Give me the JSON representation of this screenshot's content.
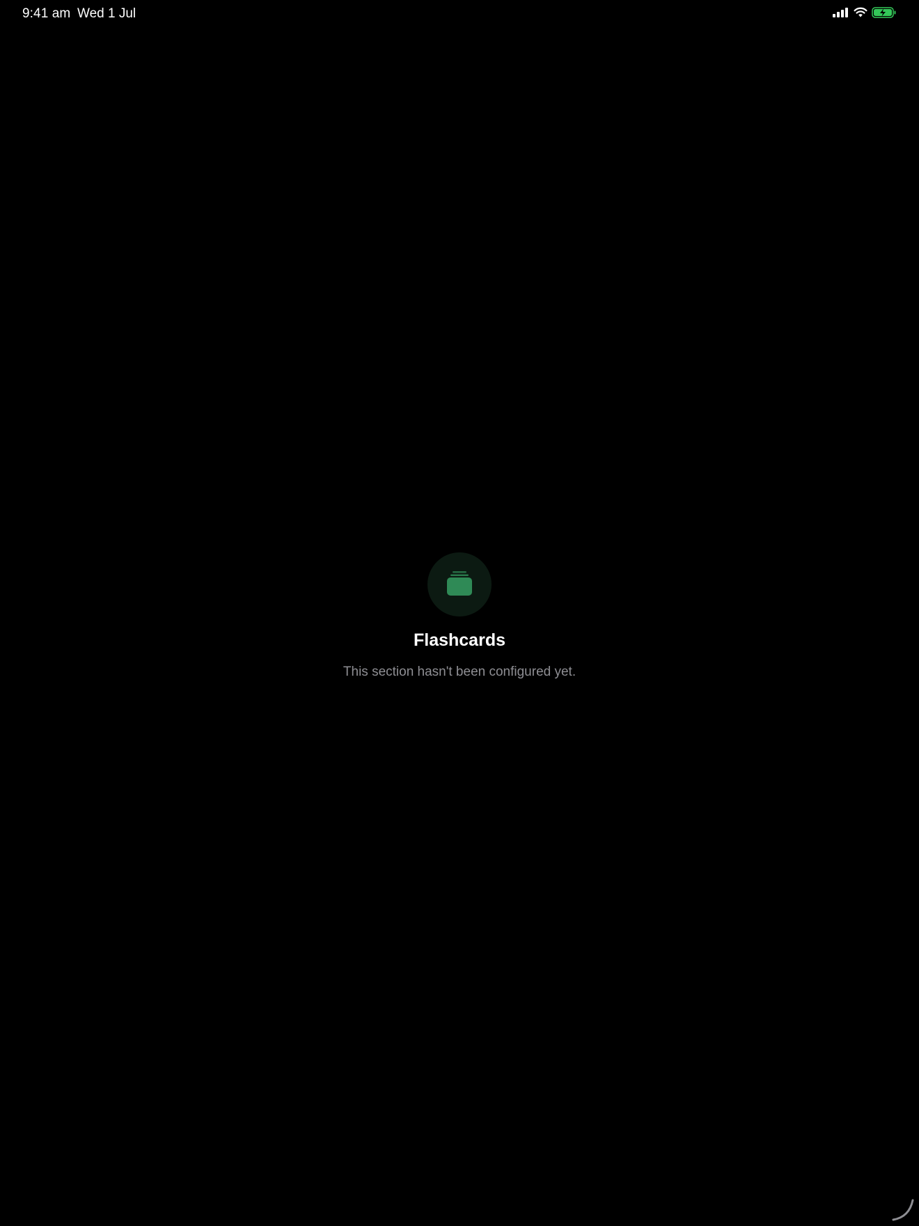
{
  "status_bar": {
    "time": "9:41 am",
    "date": "Wed 1 Jul",
    "icons": [
      "cellular-signal-icon",
      "wifi-icon",
      "battery-charging-icon"
    ],
    "battery_color": "#34c759"
  },
  "empty_state": {
    "icon": "flashcards-stack-icon",
    "accent_color": "#2f8a56",
    "title": "Flashcards",
    "message": "This section hasn't been configured yet."
  }
}
